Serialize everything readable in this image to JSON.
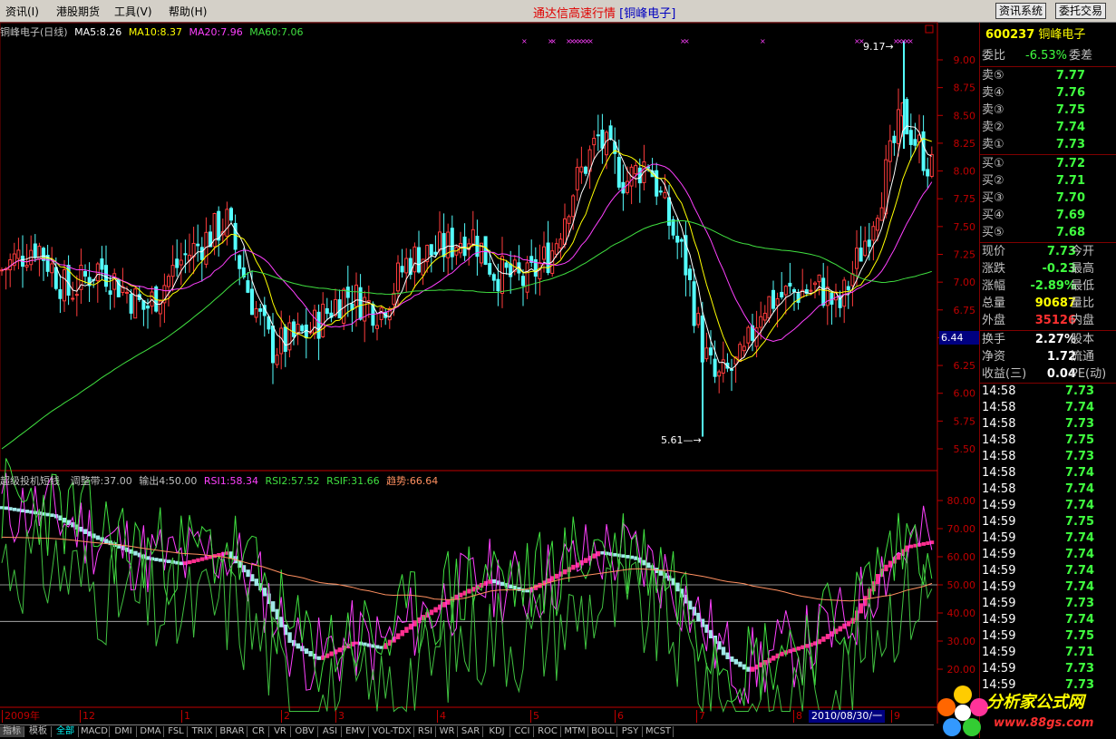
{
  "menu": {
    "items": [
      "资讯(I)",
      "港股期货",
      "工具(V)",
      "帮助(H)"
    ],
    "title_prefix": "通达信高速行情",
    "title_stock": "[铜峰电子]",
    "btn_news": "资讯系统",
    "btn_trade": "委托交易"
  },
  "main_chart": {
    "stock_label": "铜峰电子(日线)",
    "ma5": "MA5:8.26",
    "ma10": "MA10:8.37",
    "ma20": "MA20:7.96",
    "ma60": "MA60:7.06",
    "high_mark": "9.17",
    "low_mark": "5.61",
    "price_cursor": "6.44",
    "y_ticks": [
      "9.00",
      "8.75",
      "8.50",
      "8.25",
      "8.00",
      "7.75",
      "7.50",
      "7.25",
      "7.00",
      "6.75",
      "6.50",
      "6.25",
      "6.00",
      "5.75",
      "5.50"
    ],
    "colors": {
      "up": "#ff3c3c",
      "down": "#54ffff",
      "ma5": "#ffffff",
      "ma10": "#ffff00",
      "ma20": "#ff40ff",
      "ma60": "#40e040"
    }
  },
  "sub_chart": {
    "name": "超级投机短线",
    "p1": "调整带:37.00",
    "p2": "输出4:50.00",
    "rsi1": "RSI1:58.34",
    "rsi2": "RSI2:57.52",
    "rsif": "RSIF:31.66",
    "trend": "趋势:66.64",
    "y_ticks": [
      "80.00",
      "70.00",
      "60.00",
      "50.00",
      "40.00",
      "30.00",
      "20.00"
    ]
  },
  "xaxis": {
    "labels": [
      "2009年",
      "12",
      "1",
      "2",
      "3",
      "4",
      "5",
      "6",
      "7",
      "8",
      "9"
    ],
    "cursor_date": "2010/08/30/一"
  },
  "bottom_tabs": [
    "指标",
    "模板",
    "全部",
    "MACD",
    "DMI",
    "DMA",
    "FSL",
    "TRIX",
    "BRAR",
    "CR",
    "VR",
    "OBV",
    "ASI",
    "EMV",
    "VOL-TDX",
    "RSI",
    "WR",
    "SAR",
    "KDJ",
    "CCI",
    "ROC",
    "MTM",
    "BOLL",
    "PSY",
    "MCST"
  ],
  "quote": {
    "code": "600237",
    "name": "铜峰电子",
    "weibi_label": "委比",
    "weibi_value": "-6.53%",
    "weicha_label": "委差",
    "sells": [
      {
        "label": "卖⑤",
        "price": "7.77"
      },
      {
        "label": "卖④",
        "price": "7.76"
      },
      {
        "label": "卖③",
        "price": "7.75"
      },
      {
        "label": "卖②",
        "price": "7.74"
      },
      {
        "label": "卖①",
        "price": "7.73"
      }
    ],
    "buys": [
      {
        "label": "买①",
        "price": "7.72"
      },
      {
        "label": "买②",
        "price": "7.71"
      },
      {
        "label": "买③",
        "price": "7.70"
      },
      {
        "label": "买④",
        "price": "7.69"
      },
      {
        "label": "买⑤",
        "price": "7.68"
      }
    ],
    "stats": [
      {
        "label": "现价",
        "value": "7.73",
        "label2": "今开"
      },
      {
        "label": "涨跌",
        "value": "-0.23",
        "label2": "最高"
      },
      {
        "label": "涨幅",
        "value": "-2.89%",
        "label2": "最低"
      },
      {
        "label": "总量",
        "value": "90687",
        "label2": "量比"
      },
      {
        "label": "外盘",
        "value": "35126",
        "label2": "内盘"
      }
    ],
    "fundamentals": [
      {
        "label": "换手",
        "value": "2.27%",
        "label2": "股本"
      },
      {
        "label": "净资",
        "value": "1.72",
        "label2": "流通"
      },
      {
        "label": "收益(三)",
        "value": "0.04",
        "label2": "PE(动)"
      }
    ],
    "ticks": [
      {
        "time": "14:58",
        "price": "7.73"
      },
      {
        "time": "14:58",
        "price": "7.74"
      },
      {
        "time": "14:58",
        "price": "7.73"
      },
      {
        "time": "14:58",
        "price": "7.75"
      },
      {
        "time": "14:58",
        "price": "7.73"
      },
      {
        "time": "14:58",
        "price": "7.74"
      },
      {
        "time": "14:58",
        "price": "7.74"
      },
      {
        "time": "14:59",
        "price": "7.74"
      },
      {
        "time": "14:59",
        "price": "7.75"
      },
      {
        "time": "14:59",
        "price": "7.74"
      },
      {
        "time": "14:59",
        "price": "7.74"
      },
      {
        "time": "14:59",
        "price": "7.74"
      },
      {
        "time": "14:59",
        "price": "7.74"
      },
      {
        "time": "14:59",
        "price": "7.73"
      },
      {
        "time": "14:59",
        "price": "7.74"
      },
      {
        "time": "14:59",
        "price": "7.75"
      },
      {
        "time": "14:59",
        "price": "7.71"
      },
      {
        "time": "14:59",
        "price": "7.73"
      },
      {
        "time": "14:59",
        "price": "7.73"
      }
    ]
  },
  "watermark": {
    "line1": "分析家公式网",
    "line2": "www.88gs.com"
  }
}
